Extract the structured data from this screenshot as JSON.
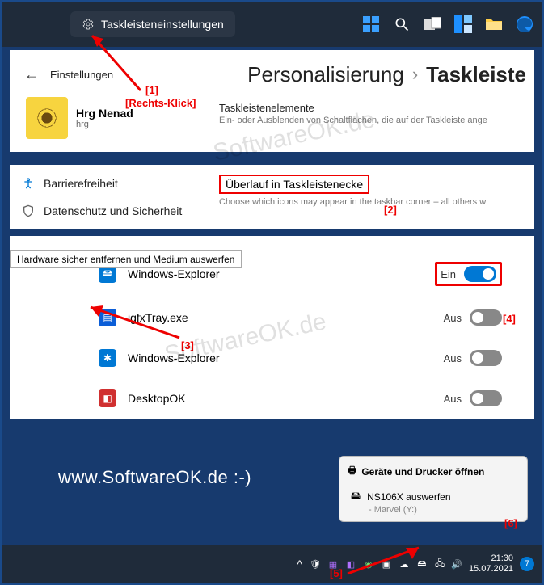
{
  "context_menu": {
    "label": "Taskleisteneinstellungen"
  },
  "settings_header": {
    "back_title": "Einstellungen",
    "crumb1": "Personalisierung",
    "crumb2": "Taskleiste"
  },
  "user": {
    "name": "Hrg Nenad",
    "sub": "hrg"
  },
  "section_elements": {
    "title": "Taskleistenelemente",
    "desc": "Ein- oder Ausblenden von Schaltflächen, die auf der Taskleiste ange"
  },
  "nav": {
    "accessibility": "Barrierefreiheit",
    "privacy": "Datenschutz und Sicherheit"
  },
  "overflow": {
    "title": "Überlauf in Taskleistenecke",
    "desc": "Choose which icons may appear in the taskbar corner – all others w"
  },
  "tooltip": "Hardware sicher entfernen und Medium auswerfen",
  "toggles": [
    {
      "name": "Windows-Explorer",
      "state": "Ein",
      "on": true,
      "icon_bg": "#0078d4",
      "glyph": "🖴"
    },
    {
      "name": "igfxTray.exe",
      "state": "Aus",
      "on": false,
      "icon_bg": "#0078d4",
      "glyph": "▤"
    },
    {
      "name": "Windows-Explorer",
      "state": "Aus",
      "on": false,
      "icon_bg": "#0078d4",
      "glyph": "✱"
    },
    {
      "name": "DesktopOK",
      "state": "Aus",
      "on": false,
      "icon_bg": "#d03030",
      "glyph": "◧"
    }
  ],
  "flyout": {
    "title": "Geräte und Drucker öffnen",
    "item": "NS106X auswerfen",
    "sub": "-   Marvel (Y:)"
  },
  "clock": {
    "time": "21:30",
    "date": "15.07.2021"
  },
  "watermark": "www.SoftwareOK.de :-)",
  "annotations": {
    "a1": "[1]",
    "a1b": "[Rechts-Klick]",
    "a2": "[2]",
    "a3": "[3]",
    "a4": "[4]",
    "a5": "[5]",
    "a6": "[6]"
  }
}
